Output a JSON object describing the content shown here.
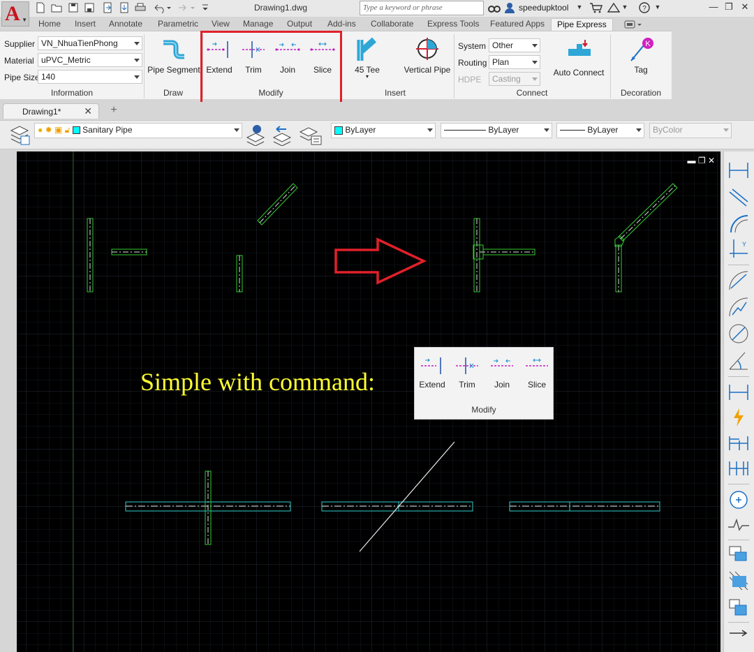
{
  "title_bar": {
    "document_title": "Drawing1.dwg",
    "search_placeholder": "Type a keyword or phrase",
    "user_name": "speedupktool",
    "app_letter": "A",
    "quick_access_icons": [
      "new-icon",
      "open-icon",
      "save-icon",
      "save-as-icon",
      "cloud-open-icon",
      "cloud-save-icon",
      "print-icon",
      "undo-icon",
      "redo-icon",
      "customize-icon"
    ]
  },
  "ribbon_tabs": [
    "Home",
    "Insert",
    "Annotate",
    "Parametric",
    "View",
    "Manage",
    "Output",
    "Add-ins",
    "Collaborate",
    "Express Tools",
    "Featured Apps",
    "Pipe Express"
  ],
  "active_tab": "Pipe Express",
  "ribbon": {
    "information": {
      "title": "Information",
      "supplier_label": "Supplier",
      "supplier_value": "VN_NhuaTienPhong",
      "material_label": "Material",
      "material_value": "uPVC_Metric",
      "pipe_size_label": "Pipe Size",
      "pipe_size_value": "140"
    },
    "draw": {
      "title": "Draw",
      "pipe_segment": "Pipe Segment"
    },
    "modify": {
      "title": "Modify",
      "extend": "Extend",
      "trim": "Trim",
      "join": "Join",
      "slice": "Slice"
    },
    "insert": {
      "title": "Insert",
      "tee": "45 Tee",
      "vertical_pipe": "Vertical Pipe"
    },
    "connect": {
      "title": "Connect",
      "system_label": "System",
      "system_value": "Other",
      "routing_label": "Routing",
      "routing_value": "Plan",
      "hdpe_label": "HDPE",
      "hdpe_value": "Casting",
      "auto_connect": "Auto Connect"
    },
    "decoration": {
      "title": "Decoration",
      "tag": "Tag",
      "tag_badge": "K"
    }
  },
  "doc_tabs": {
    "active": "Drawing1*"
  },
  "layer_bar": {
    "layer_name": "Sanitary Pipe",
    "color": "ByLayer",
    "linetype": "ByLayer",
    "lineweight": "ByLayer",
    "plot_style": "ByColor"
  },
  "canvas": {
    "annotation": "Simple with command:",
    "popup": {
      "title": "Modify",
      "extend": "Extend",
      "trim": "Trim",
      "join": "Join",
      "slice": "Slice"
    }
  },
  "colors": {
    "canvas_bg": "#000000",
    "pipe_green": "#33cc33",
    "pipe_cyan": "#33cccc",
    "annotation_yellow": "#ffff33",
    "highlight_red": "#e0202a",
    "layer_swatch": "#00ffff"
  },
  "right_toolbar_icons": [
    "linear-dimension-icon",
    "aligned-dimension-icon",
    "arc-length-icon",
    "ordinate-icon",
    "radius-icon",
    "jogged-radius-icon",
    "diameter-icon",
    "angular-icon",
    "quick-dimension-icon",
    "baseline-icon",
    "continue-icon",
    "center-mark-icon",
    "jog-line-icon",
    "edit-dimension-icon",
    "hatch-icon",
    "copy-icon",
    "leader-icon",
    "break-icon"
  ]
}
